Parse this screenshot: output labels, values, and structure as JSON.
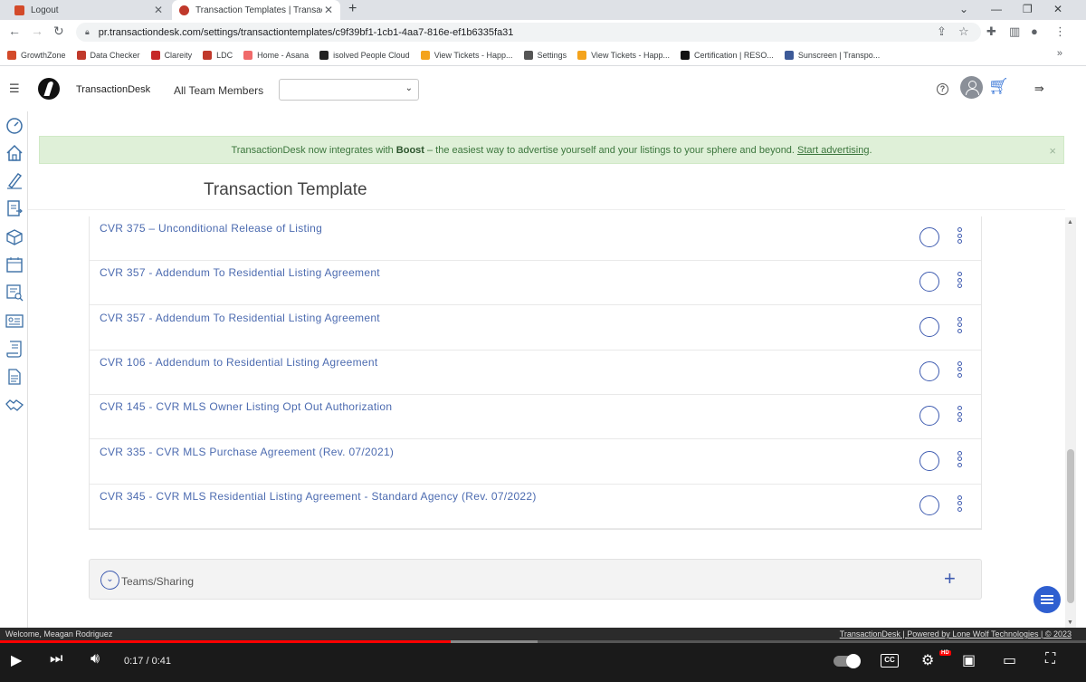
{
  "browser": {
    "tabs": [
      {
        "title": "Logout"
      },
      {
        "title": "Transaction Templates | Transacti"
      }
    ],
    "url": "pr.transactiondesk.com/settings/transactiontemplates/c9f39bf1-1cb1-4aa7-816e-ef1b6335fa31",
    "bookmarks": [
      {
        "label": "GrowthZone",
        "color": "#d34a2a"
      },
      {
        "label": "Data Checker",
        "color": "#c0392b"
      },
      {
        "label": "Clareity",
        "color": "#c62828"
      },
      {
        "label": "LDC",
        "color": "#c0392b"
      },
      {
        "label": "Home - Asana",
        "color": "#f06a6a"
      },
      {
        "label": "isolved People Cloud",
        "color": "#222222"
      },
      {
        "label": "View Tickets - Happ...",
        "color": "#f4a31c"
      },
      {
        "label": "Settings",
        "color": "#555555"
      },
      {
        "label": "View Tickets - Happ...",
        "color": "#f4a31c"
      },
      {
        "label": "Certification | RESO...",
        "color": "#111111"
      },
      {
        "label": "Sunscreen | Transpo...",
        "color": "#3d5a98"
      }
    ]
  },
  "header": {
    "brand": "TransactionDesk",
    "team_label": "All Team Members",
    "team_select_value": ""
  },
  "banner": {
    "text_before": "TransactionDesk now integrates with",
    "bold": "Boost",
    "text_after": "– the easiest way to advertise yourself and your listings to your sphere and beyond.",
    "link": "Start advertising",
    "end": ".",
    "close": "×"
  },
  "page": {
    "title": "Transaction Template"
  },
  "templates": [
    {
      "name": "CVR 375 – Unconditional Release of Listing"
    },
    {
      "name": "CVR 357 - Addendum To Residential Listing Agreement"
    },
    {
      "name": "CVR 357 - Addendum To Residential Listing Agreement"
    },
    {
      "name": "CVR 106 - Addendum to Residential Listing Agreement"
    },
    {
      "name": "CVR 145 - CVR MLS Owner Listing Opt Out Authorization"
    },
    {
      "name": "CVR 335 - CVR MLS Purchase Agreement (Rev. 07/2021)"
    },
    {
      "name": "CVR 345 - CVR MLS Residential Listing Agreement - Standard Agency (Rev. 07/2022)"
    }
  ],
  "teams_section": {
    "label": "Teams/Sharing",
    "add": "+"
  },
  "footer": {
    "welcome": "Welcome, Meagan Rodriguez",
    "credit": "TransactionDesk | Powered by Lone Wolf Technologies | © 2023"
  },
  "player": {
    "current": "0:17",
    "duration": "0:41",
    "time_display": "0:17 / 0:41",
    "progress": 0.415,
    "cc": "CC",
    "hd": "HD"
  },
  "colors": {
    "link": "#4c6bb0",
    "accent": "#3e5bb0",
    "banner_bg": "#dff0d8",
    "progress_played": "#ff0000"
  }
}
